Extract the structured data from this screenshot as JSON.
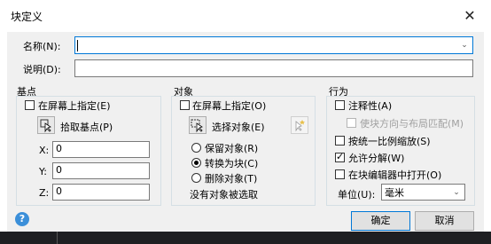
{
  "window": {
    "title": "块定义",
    "close_glyph": "✕"
  },
  "name_field": {
    "label": "名称(N):",
    "value": ""
  },
  "description_field": {
    "label": "说明(D):",
    "value": ""
  },
  "base_point": {
    "group_title": "基点",
    "specify_on_screen": "在屏幕上指定(E)",
    "pick_button": "拾取基点(P)",
    "x_label": "X:",
    "x_value": "0",
    "y_label": "Y:",
    "y_value": "0",
    "z_label": "Z:",
    "z_value": "0"
  },
  "objects": {
    "group_title": "对象",
    "specify_on_screen": "在屏幕上指定(O)",
    "select_button": "选择对象(E)",
    "retain": "保留对象(R)",
    "convert": "转换为块(C)",
    "delete": "删除对象(T)",
    "status": "没有对象被选取"
  },
  "behavior": {
    "group_title": "行为",
    "annotative": "注释性(A)",
    "match_orientation": "使块方向与布局匹配(M)",
    "scale_uniformly": "按统一比例缩放(S)",
    "allow_exploding": "允许分解(W)",
    "open_in_editor": "在块编辑器中打开(O)",
    "unit_label": "单位(U):",
    "unit_value": "毫米"
  },
  "buttons": {
    "ok": "确定",
    "cancel": "取消",
    "help": "?"
  },
  "colors": {
    "accent": "#0078d7",
    "help_icon": "#3b8fd9"
  }
}
